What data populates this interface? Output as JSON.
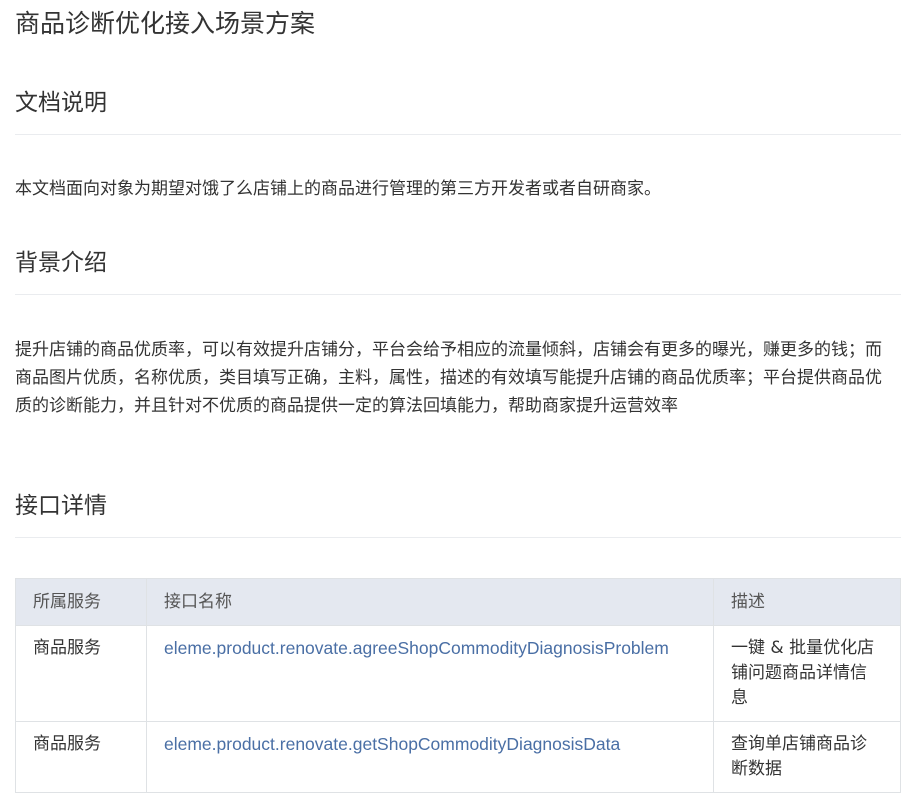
{
  "doc": {
    "title": "商品诊断优化接入场景方案"
  },
  "sections": {
    "doc_intro": {
      "heading": "文档说明",
      "text": "本文档面向对象为期望对饿了么店铺上的商品进行管理的第三方开发者或者自研商家。"
    },
    "background": {
      "heading": "背景介绍",
      "text": "提升店铺的商品优质率，可以有效提升店铺分，平台会给予相应的流量倾斜，店铺会有更多的曝光，赚更多的钱；而商品图片优质，名称优质，类目填写正确，主料，属性，描述的有效填写能提升店铺的商品优质率；平台提供商品优质的诊断能力，并且针对不优质的商品提供一定的算法回填能力，帮助商家提升运营效率"
    },
    "api_details": {
      "heading": "接口详情"
    }
  },
  "api_table": {
    "headers": {
      "service": "所属服务",
      "name": "接口名称",
      "description": "描述"
    },
    "rows": [
      {
        "service": "商品服务",
        "name": "eleme.product.renovate.agreeShopCommodityDiagnosisProblem",
        "description": "一键 & 批量优化店铺问题商品详情信息"
      },
      {
        "service": "商品服务",
        "name": "eleme.product.renovate.getShopCommodityDiagnosisData",
        "description": "查询单店铺商品诊断数据"
      }
    ]
  },
  "colors": {
    "text": "#333333",
    "link": "#4a6fa5",
    "table_header_bg": "#e4e8f0",
    "border": "#dfe2e5"
  }
}
